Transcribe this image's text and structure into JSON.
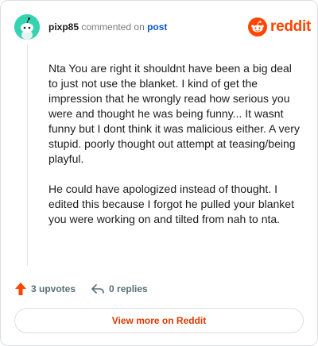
{
  "comment": {
    "username": "pixp85",
    "action_text": "commented on",
    "post_link": "post",
    "paragraphs": [
      "Nta You are right it shouldnt have been a big deal to just not use the blanket. I kind of get the impression that he wrongly read how serious you were and thought he was being funny... It wasnt funny but I dont think it was malicious either. A very stupid. poorly thought out attempt at teasing/being playful.",
      "He could have apologized instead of thought. I edited this because I forgot he pulled your blanket you were working on and tilted from nah to nta."
    ]
  },
  "brand": {
    "word": "reddit",
    "color": "#ff4500",
    "icon": "reddit-logo-icon"
  },
  "actions": {
    "upvotes": "3 upvotes",
    "replies": "0 replies",
    "upvote_icon": "upvote-arrow-icon",
    "reply_icon": "reply-arrow-icon"
  },
  "footer": {
    "view_more": "View more on Reddit"
  },
  "colors": {
    "avatar_bg": "#34d3b1",
    "upvote": "#ff4500",
    "link": "#0b57d0",
    "view_more_text": "#d93a00"
  }
}
